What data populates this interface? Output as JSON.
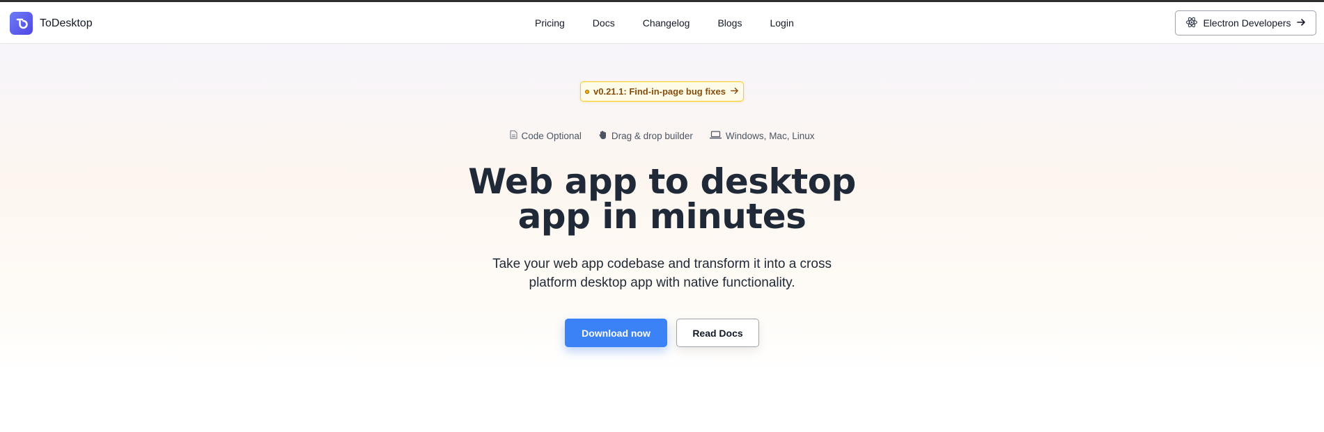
{
  "header": {
    "brand": {
      "name": "ToDesktop",
      "logo_icon": "todesktop-logo-icon"
    },
    "nav": [
      {
        "label": "Pricing"
      },
      {
        "label": "Docs"
      },
      {
        "label": "Changelog"
      },
      {
        "label": "Blogs"
      },
      {
        "label": "Login"
      }
    ],
    "electron_button": {
      "label": "Electron Developers",
      "icon": "electron-icon",
      "trailing_icon": "arrow-right-icon"
    }
  },
  "announcement": {
    "label": "v0.21.1: Find-in-page bug fixes",
    "icon": "arrow-right-icon"
  },
  "features": [
    {
      "label": "Code Optional",
      "icon": "document-icon"
    },
    {
      "label": "Drag & drop builder",
      "icon": "hand-icon"
    },
    {
      "label": "Windows, Mac, Linux",
      "icon": "laptop-icon"
    }
  ],
  "hero": {
    "title_line1": "Web app to desktop",
    "title_line2": "app in minutes",
    "subtitle_line1": "Take your web app codebase and transform it into a cross",
    "subtitle_line2": "platform desktop app with native functionality."
  },
  "cta": {
    "primary_label": "Download now",
    "secondary_label": "Read Docs"
  },
  "colors": {
    "accent": "#3b82f6",
    "logo": "#4f46e5",
    "pill_border": "#facc15",
    "pill_text": "#854d0e"
  }
}
